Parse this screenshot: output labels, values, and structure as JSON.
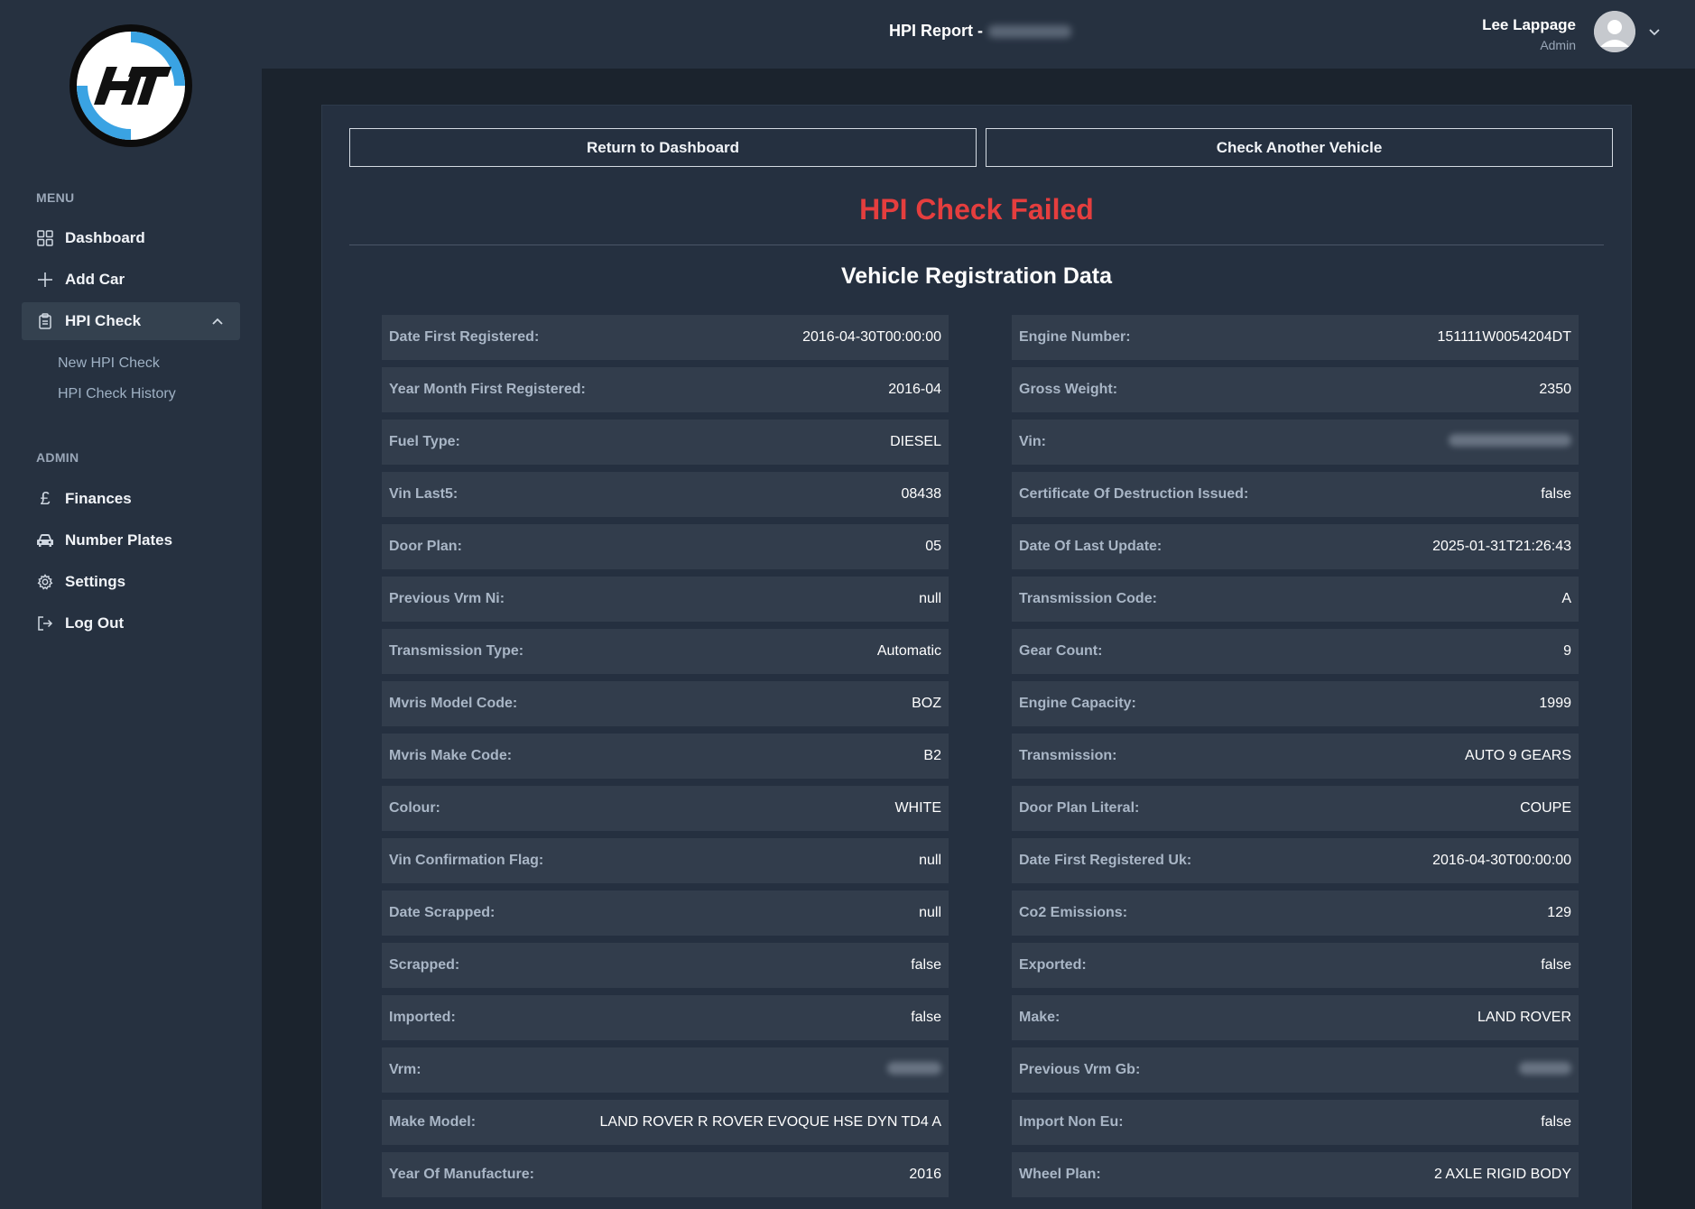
{
  "header": {
    "title_prefix": "HPI Report -",
    "user_name": "Lee Lappage",
    "user_role": "Admin"
  },
  "sidebar": {
    "menu_label": "MENU",
    "admin_label": "ADMIN",
    "menu_items": [
      {
        "label": "Dashboard",
        "icon": "grid-icon"
      },
      {
        "label": "Add Car",
        "icon": "plus-icon"
      },
      {
        "label": "HPI Check",
        "icon": "clipboard-icon",
        "active": true
      }
    ],
    "sub_items": [
      {
        "label": "New HPI Check"
      },
      {
        "label": "HPI Check History"
      }
    ],
    "admin_items": [
      {
        "label": "Finances",
        "icon": "pound-icon"
      },
      {
        "label": "Number Plates",
        "icon": "car-icon"
      },
      {
        "label": "Settings",
        "icon": "gear-icon"
      },
      {
        "label": "Log Out",
        "icon": "logout-icon"
      }
    ]
  },
  "main": {
    "return_button": "Return to Dashboard",
    "check_button": "Check Another Vehicle",
    "status_title": "HPI Check Failed",
    "status_color": "#e53e3e",
    "section_title": "Vehicle Registration Data",
    "left_rows": [
      {
        "label": "Date First Registered:",
        "value": "2016-04-30T00:00:00"
      },
      {
        "label": "Year Month First Registered:",
        "value": "2016-04"
      },
      {
        "label": "Fuel Type:",
        "value": "DIESEL"
      },
      {
        "label": "Vin Last5:",
        "value": "08438"
      },
      {
        "label": "Door Plan:",
        "value": "05"
      },
      {
        "label": "Previous Vrm Ni:",
        "value": "null"
      },
      {
        "label": "Transmission Type:",
        "value": "Automatic"
      },
      {
        "label": "Mvris Model Code:",
        "value": "BOZ"
      },
      {
        "label": "Mvris Make Code:",
        "value": "B2"
      },
      {
        "label": "Colour:",
        "value": "WHITE"
      },
      {
        "label": "Vin Confirmation Flag:",
        "value": "null"
      },
      {
        "label": "Date Scrapped:",
        "value": "null"
      },
      {
        "label": "Scrapped:",
        "value": "false"
      },
      {
        "label": "Imported:",
        "value": "false"
      },
      {
        "label": "Vrm:",
        "value": ""
      },
      {
        "label": "Make Model:",
        "value": "LAND ROVER R ROVER EVOQUE HSE DYN TD4 A"
      },
      {
        "label": "Year Of Manufacture:",
        "value": "2016"
      }
    ],
    "right_rows": [
      {
        "label": "Engine Number:",
        "value": "151111W0054204DT"
      },
      {
        "label": "Gross Weight:",
        "value": "2350"
      },
      {
        "label": "Vin:",
        "value": ""
      },
      {
        "label": "Certificate Of Destruction Issued:",
        "value": "false"
      },
      {
        "label": "Date Of Last Update:",
        "value": "2025-01-31T21:26:43"
      },
      {
        "label": "Transmission Code:",
        "value": "A"
      },
      {
        "label": "Gear Count:",
        "value": "9"
      },
      {
        "label": "Engine Capacity:",
        "value": "1999"
      },
      {
        "label": "Transmission:",
        "value": "AUTO 9 GEARS"
      },
      {
        "label": "Door Plan Literal:",
        "value": "COUPE"
      },
      {
        "label": "Date First Registered Uk:",
        "value": "2016-04-30T00:00:00"
      },
      {
        "label": "Co2 Emissions:",
        "value": "129"
      },
      {
        "label": "Exported:",
        "value": "false"
      },
      {
        "label": "Make:",
        "value": "LAND ROVER"
      },
      {
        "label": "Previous Vrm Gb:",
        "value": ""
      },
      {
        "label": "Import Non Eu:",
        "value": "false"
      },
      {
        "label": "Wheel Plan:",
        "value": "2 AXLE RIGID BODY"
      }
    ]
  }
}
